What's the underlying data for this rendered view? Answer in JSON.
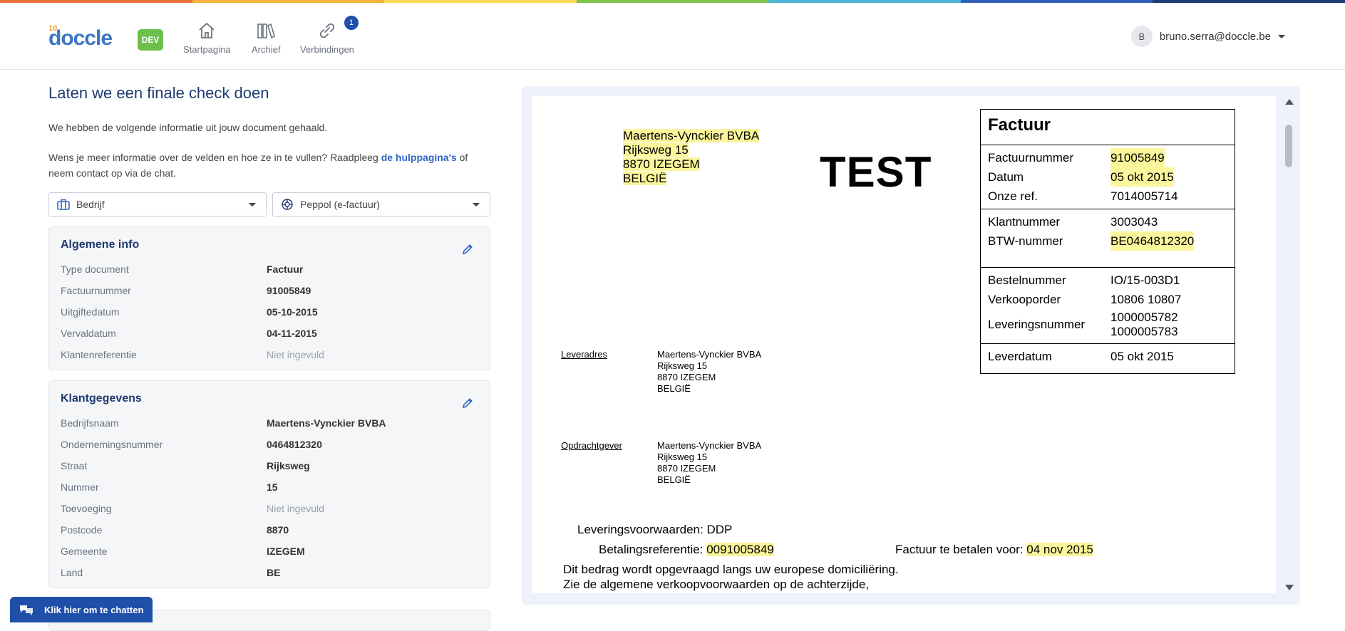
{
  "colors": {
    "primary": "#1f4fa8",
    "title": "#1e3a70",
    "dev": "#6cc04a",
    "highlight": "#fbf59b"
  },
  "header": {
    "logo_prefix": "10",
    "logo": "doccle",
    "env_badge": "DEV",
    "nav": [
      {
        "label": "Startpagina",
        "icon": "home-icon"
      },
      {
        "label": "Archief",
        "icon": "archive-icon"
      },
      {
        "label": "Verbindingen",
        "icon": "link-icon",
        "badge": "1"
      }
    ],
    "user": {
      "initial": "B",
      "email": "bruno.serra@doccle.be"
    }
  },
  "main": {
    "title": "Laten we een finale check doen",
    "intro": "We hebben de volgende informatie uit jouw document gehaald.",
    "help_prefix": "Wens je meer informatie over de velden en hoe ze in te vullen? Raadpleeg ",
    "help_link": "de hulppagina's",
    "help_suffix": " of neem contact op via de chat.",
    "select_type": "Bedrijf",
    "select_channel": "Peppol (e-factuur)",
    "general": {
      "title": "Algemene info",
      "rows": [
        {
          "k": "Type document",
          "v": "Factuur"
        },
        {
          "k": "Factuurnummer",
          "v": "91005849"
        },
        {
          "k": "Uitgiftedatum",
          "v": "05-10-2015"
        },
        {
          "k": "Vervaldatum",
          "v": "04-11-2015"
        },
        {
          "k": "Klantenreferentie",
          "v": "Niet ingevuld"
        }
      ]
    },
    "customer": {
      "title": "Klantgegevens",
      "rows": [
        {
          "k": "Bedrijfsnaam",
          "v": "Maertens-Vynckier BVBA"
        },
        {
          "k": "Ondernemingsnummer",
          "v": "0464812320"
        },
        {
          "k": "Straat",
          "v": "Rijksweg"
        },
        {
          "k": "Nummer",
          "v": "15"
        },
        {
          "k": "Toevoeging",
          "v": "Niet ingevuld"
        },
        {
          "k": "Postcode",
          "v": "8870"
        },
        {
          "k": "Gemeente",
          "v": "IZEGEM"
        },
        {
          "k": "Land",
          "v": "BE"
        }
      ]
    },
    "chat_label": "Klik hier om te chatten"
  },
  "document": {
    "address": [
      "Maertens-Vynckier BVBA",
      "Rijksweg 15",
      "8870 IZEGEM",
      "BELGIË"
    ],
    "watermark": "TEST",
    "invoice_title": "Factuur",
    "sec1": [
      {
        "k": "Factuurnummer",
        "v": "91005849"
      },
      {
        "k": "Datum",
        "v": "05 okt 2015"
      },
      {
        "k": "Onze ref.",
        "v": "7014005714"
      }
    ],
    "sec2": [
      {
        "k": "Klantnummer",
        "v": "3003043"
      },
      {
        "k": "BTW-nummer",
        "v": "BE0464812320"
      }
    ],
    "sec3": [
      {
        "k": "Bestelnummer",
        "v": "IO/15-003D1"
      },
      {
        "k": "Verkooporder",
        "v": "10806 10807"
      },
      {
        "k": "Leveringsnummer",
        "v1": "1000005782",
        "v2": "1000005783"
      }
    ],
    "sec4": [
      {
        "k": "Leverdatum",
        "v": "05 okt 2015"
      }
    ],
    "delivery_label": "Leveradres",
    "delivery_address": [
      "Maertens-Vynckier BVBA",
      "Rijksweg 15",
      "8870 IZEGEM",
      "BELGIË"
    ],
    "orderer_label": "Opdrachtgever",
    "orderer_address": [
      "Maertens-Vynckier BVBA",
      "Rijksweg 15",
      "8870 IZEGEM",
      "BELGIË"
    ],
    "delivery_terms": "Leveringsvoorwaarden: DDP",
    "payment_ref_label": "Betalingsreferentie: ",
    "payment_ref": "0091005849",
    "pay_by_label": "Factuur te betalen voor: ",
    "pay_by": "04 nov 2015",
    "line1": "Dit bedrag wordt opgevraagd langs uw europese domiciliëring.",
    "line2": "Zie de algemene verkoopvoorwaarden op de achterzijde,"
  }
}
